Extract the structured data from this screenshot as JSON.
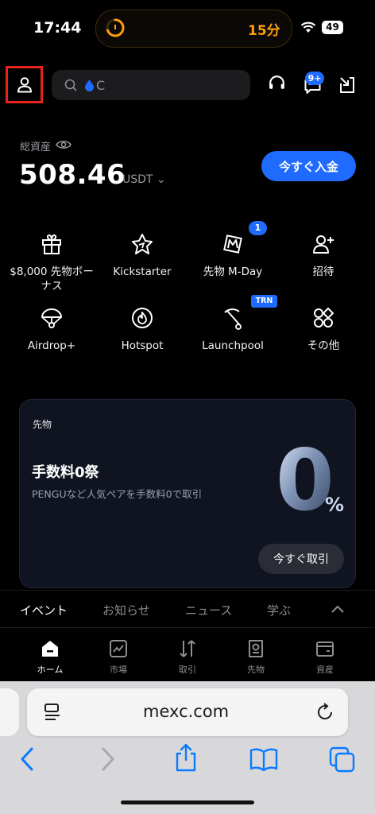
{
  "status_bar": {
    "time": "17:44",
    "timer": "15分",
    "battery": "49"
  },
  "search": {
    "text": "C"
  },
  "header": {
    "notifications_badge": "9+"
  },
  "assets": {
    "label": "総資産",
    "value": "508.46",
    "unit": "USDT ⌄",
    "deposit_label": "今すぐ入金"
  },
  "quick_actions": [
    {
      "label": "$8,000 先物ボーナス",
      "icon": "gift-icon"
    },
    {
      "label": "Kickstarter",
      "icon": "rocket-icon"
    },
    {
      "label": "先物 M-Day",
      "icon": "m-day-icon",
      "badge": "1"
    },
    {
      "label": "招待",
      "icon": "invite-user-icon"
    },
    {
      "label": "Airdrop+",
      "icon": "parachute-icon"
    },
    {
      "label": "Hotspot",
      "icon": "flame-icon"
    },
    {
      "label": "Launchpool",
      "icon": "pickaxe-icon",
      "badge": "TRN"
    },
    {
      "label": "その他",
      "icon": "grid-icon"
    }
  ],
  "promo": {
    "tag": "先物",
    "title": "手数料0祭",
    "description": "PENGUなど人気ペアを手数料0で取引",
    "big_number": "0",
    "percent": "%",
    "button": "今すぐ取引"
  },
  "info_tabs": [
    {
      "label": "イベント",
      "active": true
    },
    {
      "label": "お知らせ",
      "active": false
    },
    {
      "label": "ニュース",
      "active": false
    },
    {
      "label": "学ぶ",
      "active": false
    }
  ],
  "bottom_nav": [
    {
      "label": "ホーム",
      "icon": "home-icon",
      "active": true
    },
    {
      "label": "市場",
      "icon": "market-chart-icon",
      "active": false
    },
    {
      "label": "取引",
      "icon": "trade-arrows-icon",
      "active": false
    },
    {
      "label": "先物",
      "icon": "futures-doc-icon",
      "active": false
    },
    {
      "label": "資産",
      "icon": "wallet-icon",
      "active": false
    }
  ],
  "browser": {
    "url": "mexc.com"
  },
  "colors": {
    "accent": "#1f6bff",
    "highlight": "#e8231a",
    "timer": "#ff9f0a",
    "ios_blue": "#0a7aff"
  }
}
